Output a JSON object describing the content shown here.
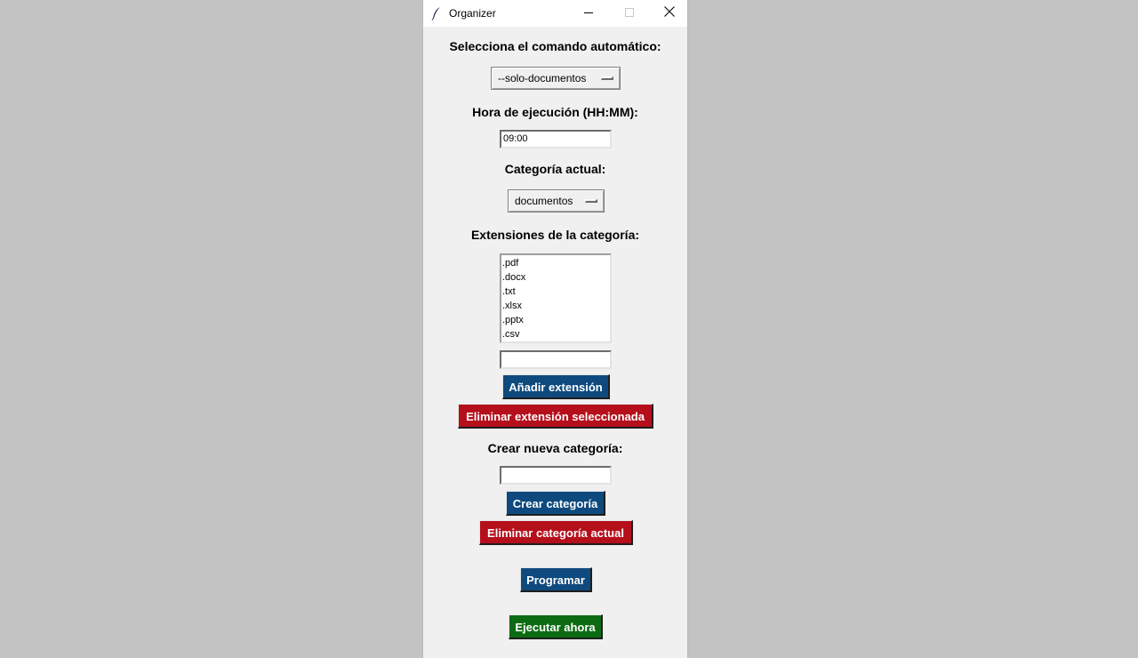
{
  "window": {
    "title": "Organizer",
    "controls": [
      "minimize",
      "maximize",
      "close"
    ]
  },
  "command": {
    "label": "Selecciona el comando automático:",
    "selected": "--solo-documentos"
  },
  "time": {
    "label": "Hora de ejecución (HH:MM):",
    "value": "09:00"
  },
  "category": {
    "label": "Categoría actual:",
    "selected": "documentos"
  },
  "extensions": {
    "label": "Extensiones de la categoría:",
    "items": [
      ".pdf",
      ".docx",
      ".txt",
      ".xlsx",
      ".pptx",
      ".csv"
    ],
    "new_value": "",
    "add_button": "Añadir extensión",
    "remove_button": "Eliminar extensión seleccionada"
  },
  "new_category": {
    "label": "Crear nueva categoría:",
    "value": "",
    "create_button": "Crear categoría",
    "delete_button": "Eliminar categoría actual"
  },
  "actions": {
    "schedule_button": "Programar",
    "run_button": "Ejecutar ahora"
  },
  "colors": {
    "background": "#c3c3c3",
    "window": "#f0f0f0",
    "blue_button": "#0e4a7e",
    "red_button": "#b50f1c",
    "green_button": "#0c6b12"
  },
  "icons": {
    "app": "feather-icon",
    "minimize": "minimize-icon",
    "maximize": "maximize-icon",
    "close": "close-icon"
  }
}
